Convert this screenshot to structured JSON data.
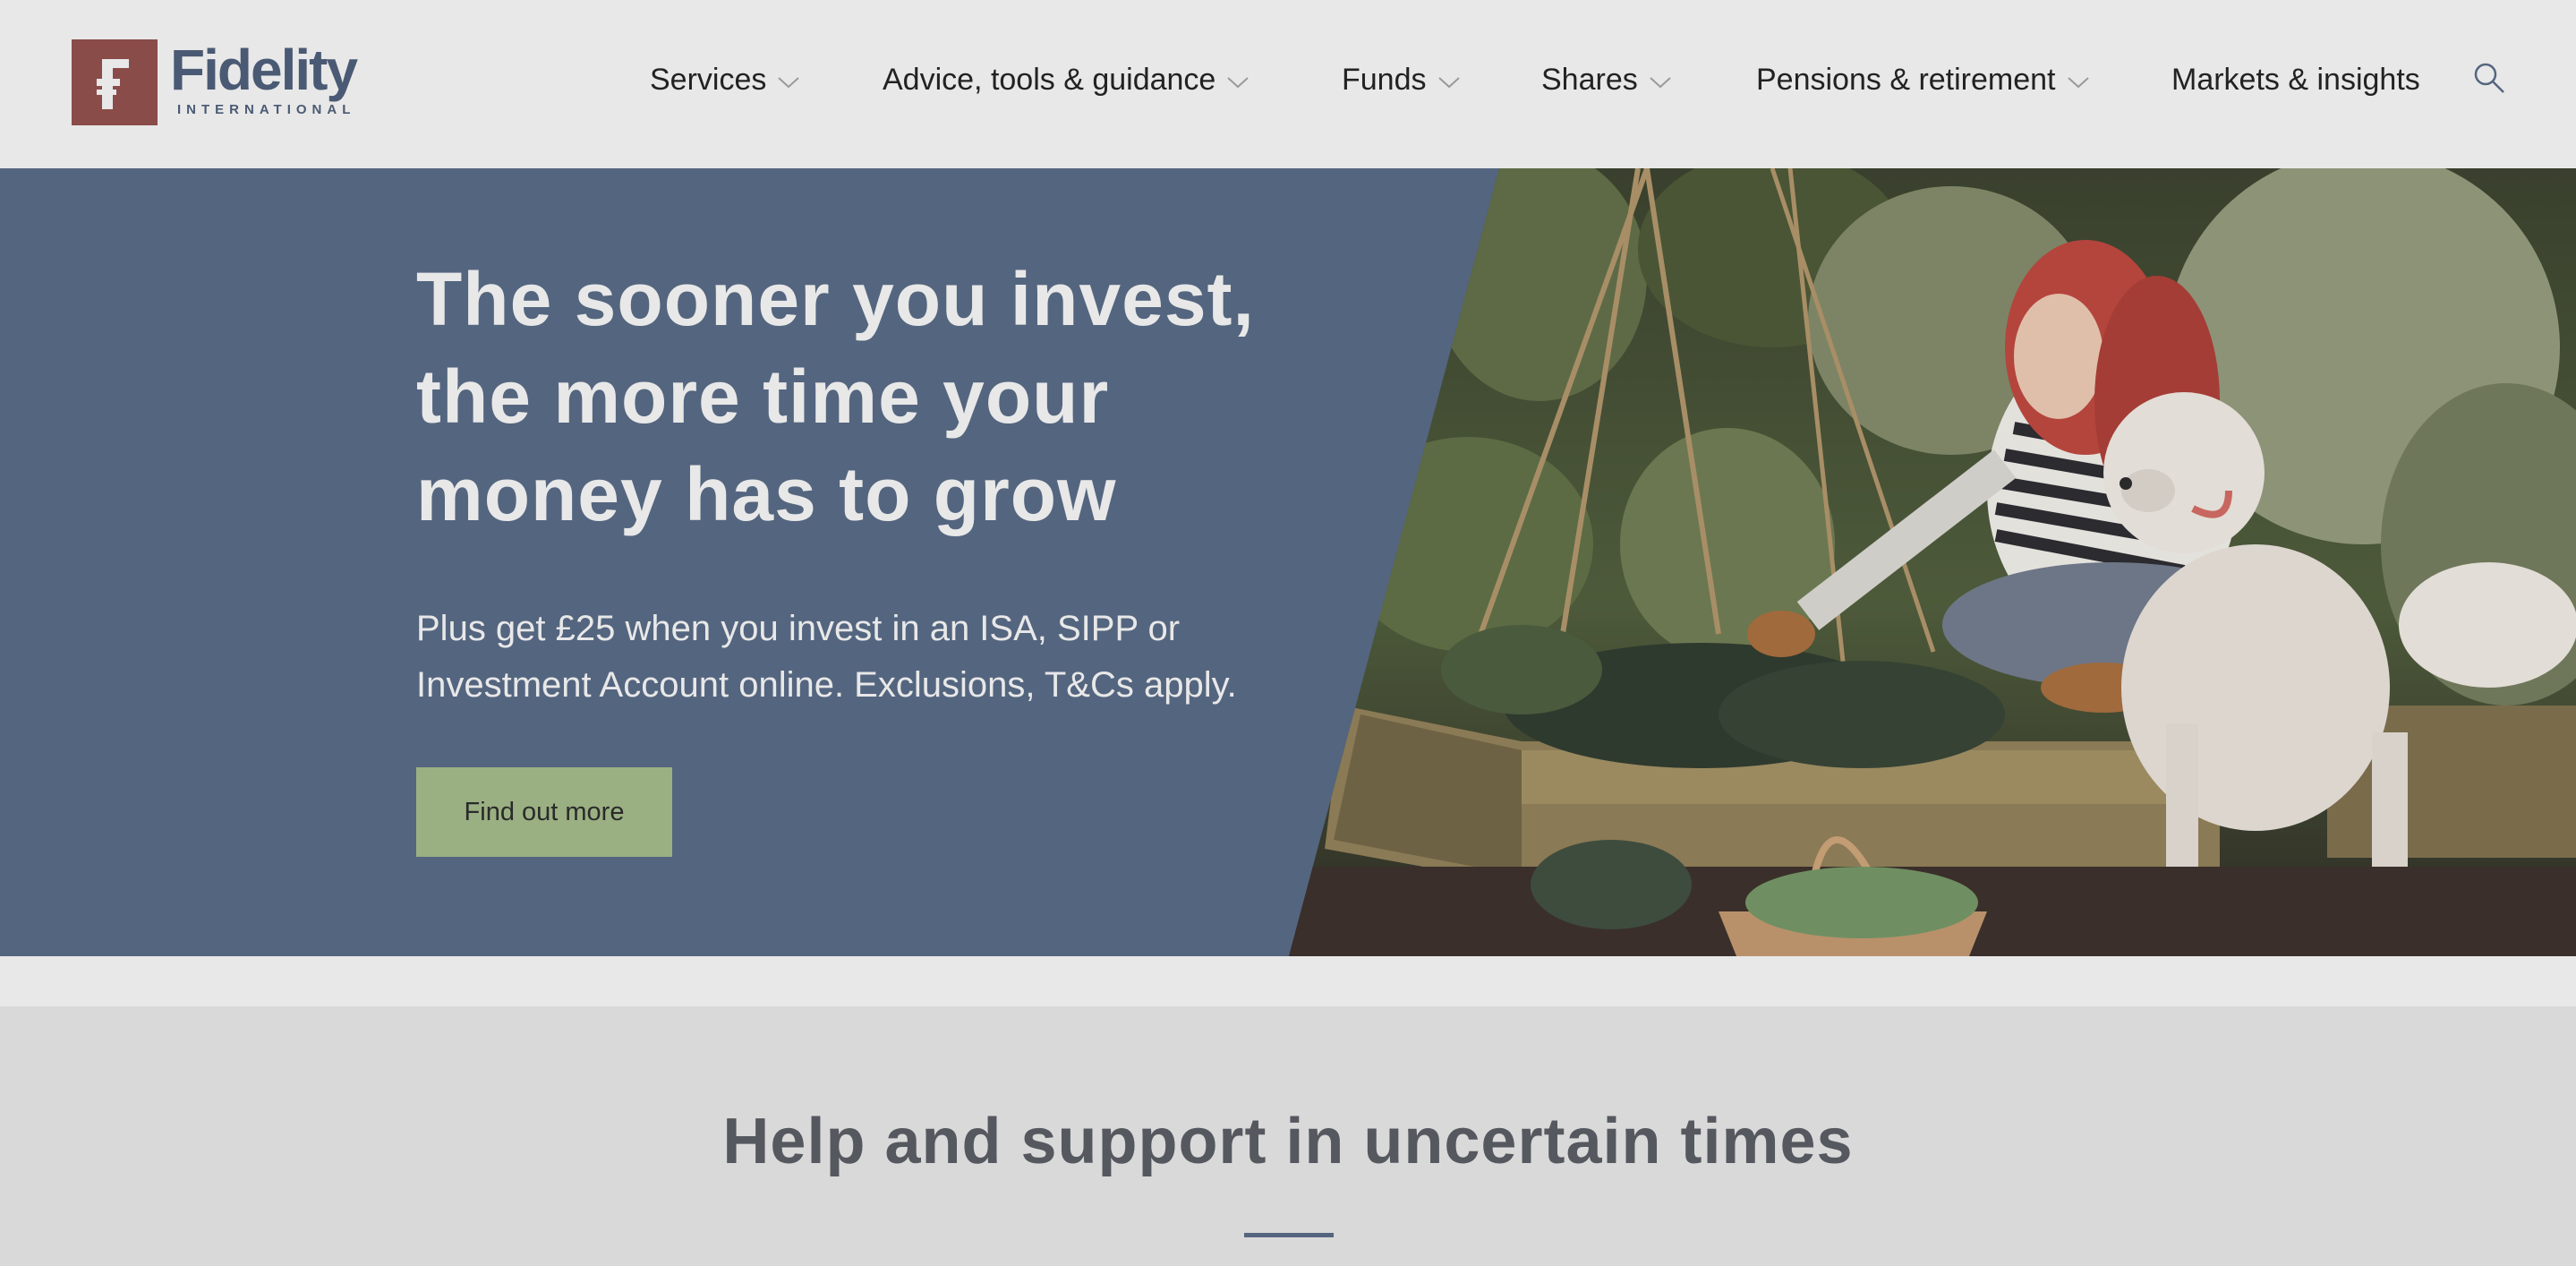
{
  "brand": {
    "name": "Fidelity",
    "subtitle": "INTERNATIONAL",
    "logo_mark_color": "#8a4c48",
    "text_color": "#4a5a74"
  },
  "nav": {
    "items": [
      {
        "label": "Services",
        "has_dropdown": true
      },
      {
        "label": "Advice, tools & guidance",
        "has_dropdown": true
      },
      {
        "label": "Funds",
        "has_dropdown": true
      },
      {
        "label": "Shares",
        "has_dropdown": true
      },
      {
        "label": "Pensions & retirement",
        "has_dropdown": true
      },
      {
        "label": "Markets & insights",
        "has_dropdown": false
      }
    ],
    "search_icon": "search-icon"
  },
  "hero": {
    "title_lines": [
      "The sooner you invest,",
      "the more time your",
      "money has to grow"
    ],
    "subtitle_lines": [
      "Plus get £25 when you invest in an ISA, SIPP or",
      "Investment Account online. Exclusions, T&Cs apply."
    ],
    "cta_label": "Find out more",
    "panel_color": "#54657f",
    "cta_color": "#9bb082"
  },
  "help": {
    "title": "Help and support in uncertain times",
    "rule_color": "#54657f"
  }
}
